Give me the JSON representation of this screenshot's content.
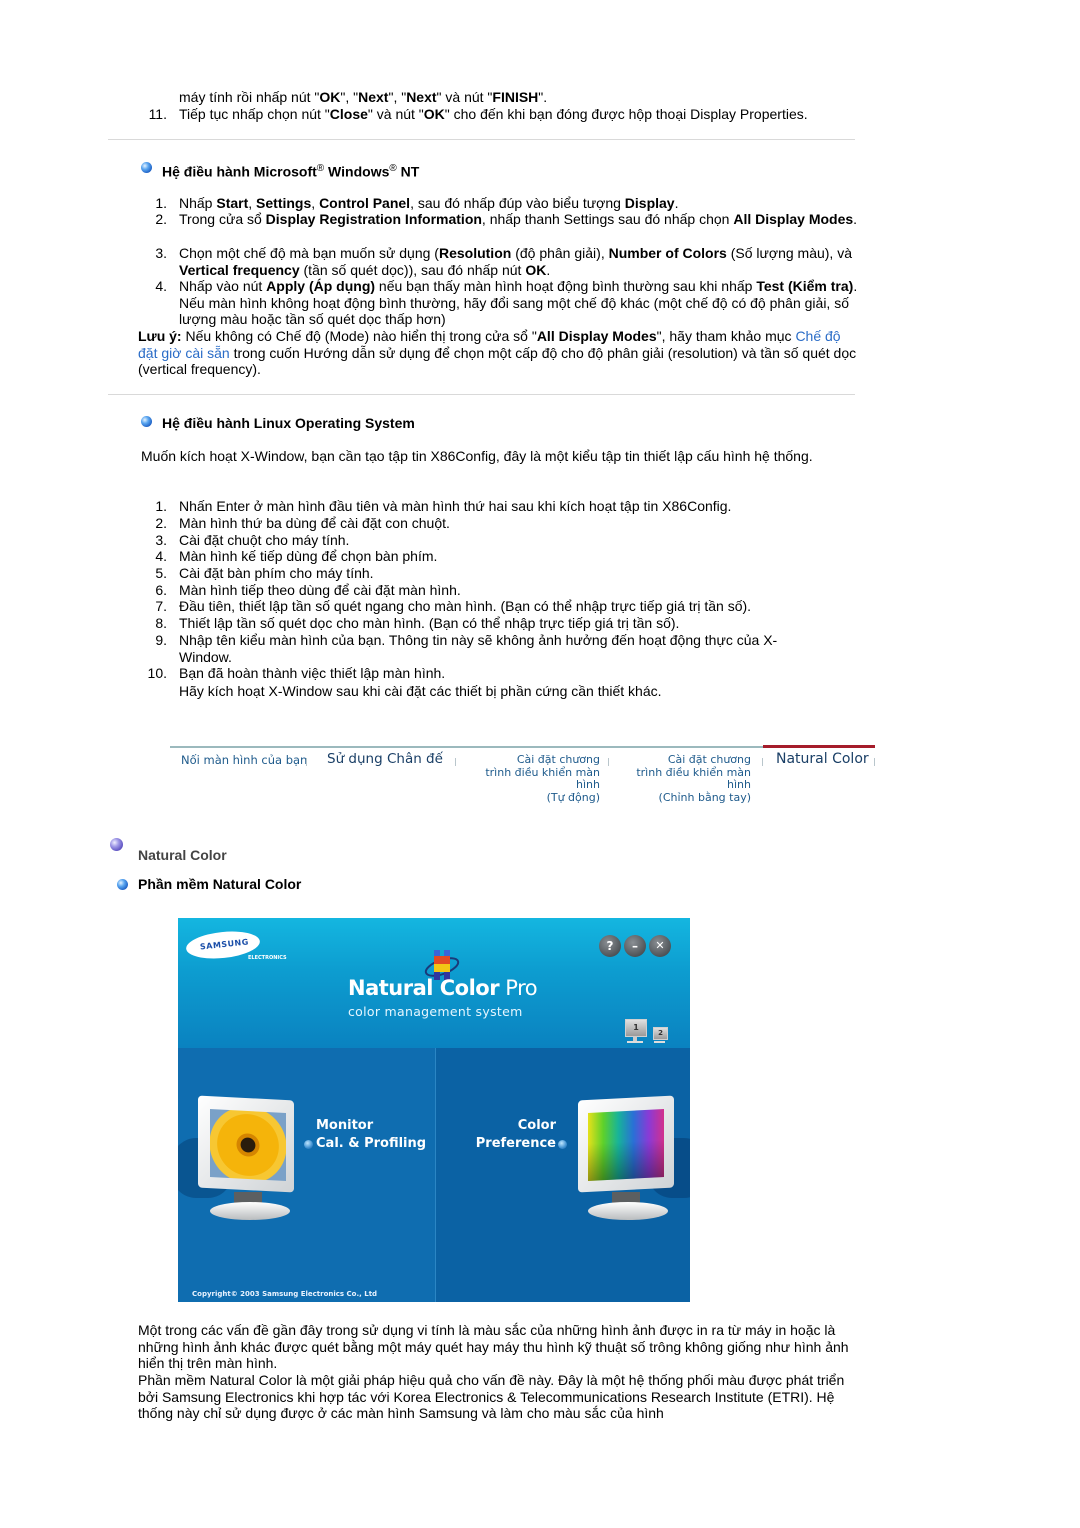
{
  "top_steps": {
    "cont_line": [
      "máy tính rồi nhấp nút \"",
      "OK",
      "\", \"",
      "Next",
      "\", \"",
      "Next",
      "\" và nút \"",
      "FINISH",
      "\"."
    ],
    "step11_num": "11.",
    "step11": [
      "Tiếp tục nhấp chọn nút \"",
      "Close",
      "\" và nút \"",
      "OK",
      "\" cho đến khi bạn đóng được hộp thoại Display Properties."
    ]
  },
  "winnt": {
    "title_pre": "Hệ điều hành Microsoft",
    "reg": "®",
    "title_mid": " Windows",
    "title_post": " NT",
    "steps": [
      {
        "num": "1.",
        "parts": [
          "Nhấp ",
          "Start",
          ", ",
          "Settings",
          ", ",
          "Control Panel",
          ", sau đó nhấp đúp vào biểu tượng ",
          "Display",
          "."
        ]
      },
      {
        "num": "2.",
        "parts": [
          "Trong cửa sổ ",
          "Display Registration Information",
          ", nhấp thanh Settings sau đó nhấp chọn ",
          "All Display Modes",
          "."
        ]
      },
      {
        "num": "3.",
        "parts": [
          "Chọn một chế độ mà bạn muốn sử dụng (",
          "Resolution",
          " (độ phân giải), ",
          "Number of Colors",
          " (Số lượng màu), và ",
          "Vertical frequency",
          " (tần số quét dọc)), sau đó nhấp nút ",
          "OK",
          "."
        ]
      },
      {
        "num": "4.",
        "parts": [
          "Nhấp vào nút ",
          "Apply (Áp dụng)",
          " nếu bạn thấy màn hình hoạt động bình thường sau khi nhấp ",
          "Test (Kiểm tra)",
          ". Nếu màn hình không hoạt động bình thường, hãy đổi sang một chế độ khác (một chế độ có độ phân giải, số lượng màu hoặc tần số quét dọc thấp hơn)"
        ]
      }
    ],
    "note_label": "Lưu ý:",
    "note_a": " Nếu không có Chế độ (Mode) nào hiển thị trong cửa sổ \"",
    "note_bold": "All Display Modes",
    "note_b": "\", hãy tham khảo mục ",
    "note_link": "Chế độ đặt giờ cài sẵn",
    "note_c": " trong cuốn Hướng dẫn sử dụng để chọn một cấp độ cho độ phân giải (resolution) và tần số quét dọc (vertical frequency)."
  },
  "linux": {
    "title": "Hệ điều hành Linux Operating System",
    "intro": "Muốn kích hoạt X-Window, bạn cần tạo tập tin X86Config, đây là một kiểu tập tin thiết lập cấu hình hệ thống.",
    "steps": [
      {
        "num": "1.",
        "text": "Nhấn Enter ở màn hình đầu tiên và màn hình thứ hai sau khi kích hoạt tập tin X86Config."
      },
      {
        "num": "2.",
        "text": "Màn hình thứ ba dùng để cài đặt con chuột."
      },
      {
        "num": "3.",
        "text": "Cài đặt chuột cho máy tính."
      },
      {
        "num": "4.",
        "text": "Màn hình kế tiếp dùng để chọn bàn phím."
      },
      {
        "num": "5.",
        "text": "Cài đặt bàn phím cho máy tính."
      },
      {
        "num": "6.",
        "text": "Màn hình tiếp theo dùng để cài đặt màn hình."
      },
      {
        "num": "7.",
        "text": "Đầu tiên, thiết lập tần số quét ngang cho màn hình. (Bạn có thể nhập trực tiếp giá trị tần số)."
      },
      {
        "num": "8.",
        "text": "Thiết lập tần số quét dọc cho màn hình. (Bạn có thể nhập trực tiếp giá trị tần số)."
      },
      {
        "num": "9.",
        "text": "Nhập tên kiểu màn hình của bạn. Thông tin này sẽ không ảnh hưởng đến hoạt động thực của X-Window."
      },
      {
        "num": "10.",
        "text": "Bạn đã hoàn thành việc thiết lập màn hình."
      }
    ],
    "step10_extra": "Hãy kích hoạt X-Window sau khi cài đặt các thiết bị phần cứng cần thiết khác."
  },
  "nav": {
    "tabs": [
      {
        "lines": [
          "Nối màn hình của bạn"
        ]
      },
      {
        "lines": [
          "Sử dụng Chân đế"
        ]
      },
      {
        "lines": [
          "Cài đặt chương",
          "trình điều khiển màn hình",
          "(Tự động)"
        ]
      },
      {
        "lines": [
          "Cài đặt chương",
          "trình điều khiển màn hình",
          "(Chỉnh bằng tay)"
        ]
      },
      {
        "lines": [
          "Natural Color"
        ]
      }
    ],
    "active_index": 4,
    "active_color": "#a51c2a"
  },
  "natural": {
    "heading": "Natural Color",
    "subheading": "Phần mềm Natural Color"
  },
  "app": {
    "brand": "SAMSUNG",
    "brand_sub": "ELECTRONICS",
    "title_bold": "Natural Color",
    "title_light": " Pro",
    "subtitle": "color management system",
    "controls": [
      {
        "icon": "help-icon",
        "glyph": "?"
      },
      {
        "icon": "minimize-icon",
        "glyph": "–"
      },
      {
        "icon": "close-icon",
        "glyph": "✕"
      }
    ],
    "monitor_1": "1",
    "monitor_2": "2",
    "option_left_line1": "Monitor",
    "option_left_line2": "Cal. & Profiling",
    "option_right_line1": "Color",
    "option_right_line2": "Preference",
    "copyright": "Copyright© 2003 Samsung Electronics Co., Ltd"
  },
  "body": {
    "para1": "Một trong các vấn đề gần đây trong sử dụng vi tính là màu sắc của những hình ảnh được in ra từ máy in hoặc là những hình ảnh khác được quét bằng một máy quét hay máy thu hình kỹ thuật số trông không giống như hình ảnh hiển thị trên màn hình.",
    "para2": "Phần mềm Natural Color là một giải pháp hiệu quả cho vấn đề này. Đây là một hệ thống phối màu được phát triển bởi Samsung Electronics khi hợp tác với Korea Electronics & Telecommunications Research Institute (ETRI). Hệ thống này chỉ sử dụng được ở các màn hình Samsung và làm cho màu sắc của hình"
  }
}
